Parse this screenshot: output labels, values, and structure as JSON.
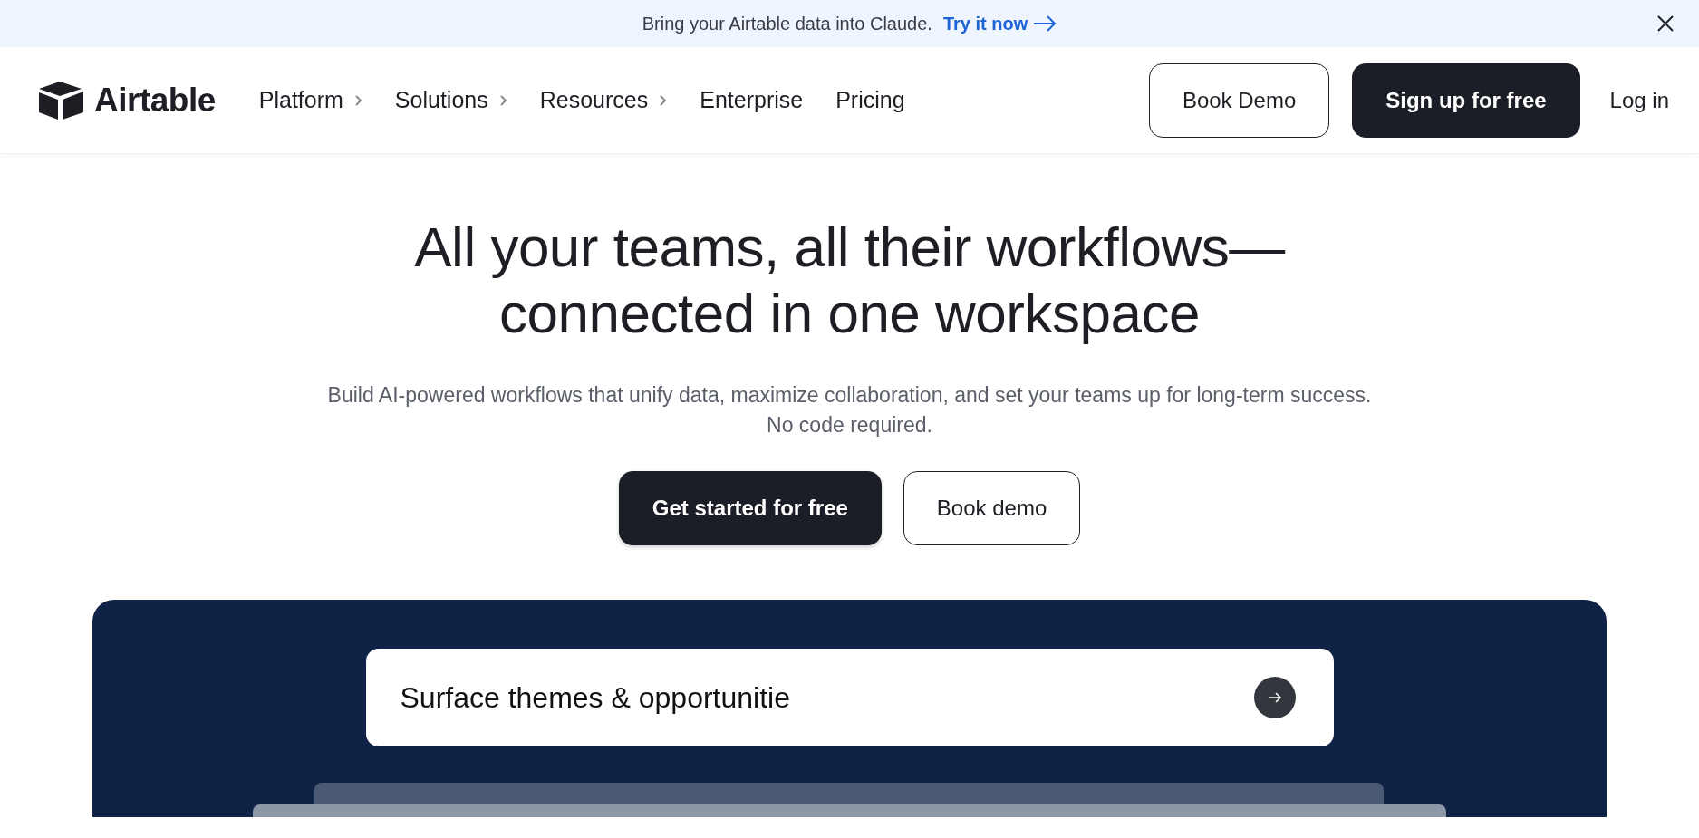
{
  "banner": {
    "text": "Bring your Airtable data into Claude.",
    "link": "Try it now"
  },
  "nav": {
    "logo": "Airtable",
    "items": [
      {
        "label": "Platform",
        "has_submenu": true
      },
      {
        "label": "Solutions",
        "has_submenu": true
      },
      {
        "label": "Resources",
        "has_submenu": true
      },
      {
        "label": "Enterprise",
        "has_submenu": false
      },
      {
        "label": "Pricing",
        "has_submenu": false
      }
    ],
    "actions": [
      {
        "label": "Book Demo",
        "kind": "outline"
      },
      {
        "label": "Sign up for free",
        "kind": "solid"
      },
      {
        "label": "Log in",
        "kind": "link"
      }
    ]
  },
  "hero": {
    "title_lines": [
      "All your teams, all their workflows—",
      "connected in one workspace"
    ],
    "subtitle": "Build AI-powered workflows that unify data, maximize collaboration, and set your teams up for long-term success. No code required.",
    "buttons": [
      {
        "label": "Get started for free",
        "kind": "solid"
      },
      {
        "label": "Book demo",
        "kind": "outline"
      }
    ]
  },
  "demo": {
    "prompt": "Surface themes & opportunitie"
  }
}
